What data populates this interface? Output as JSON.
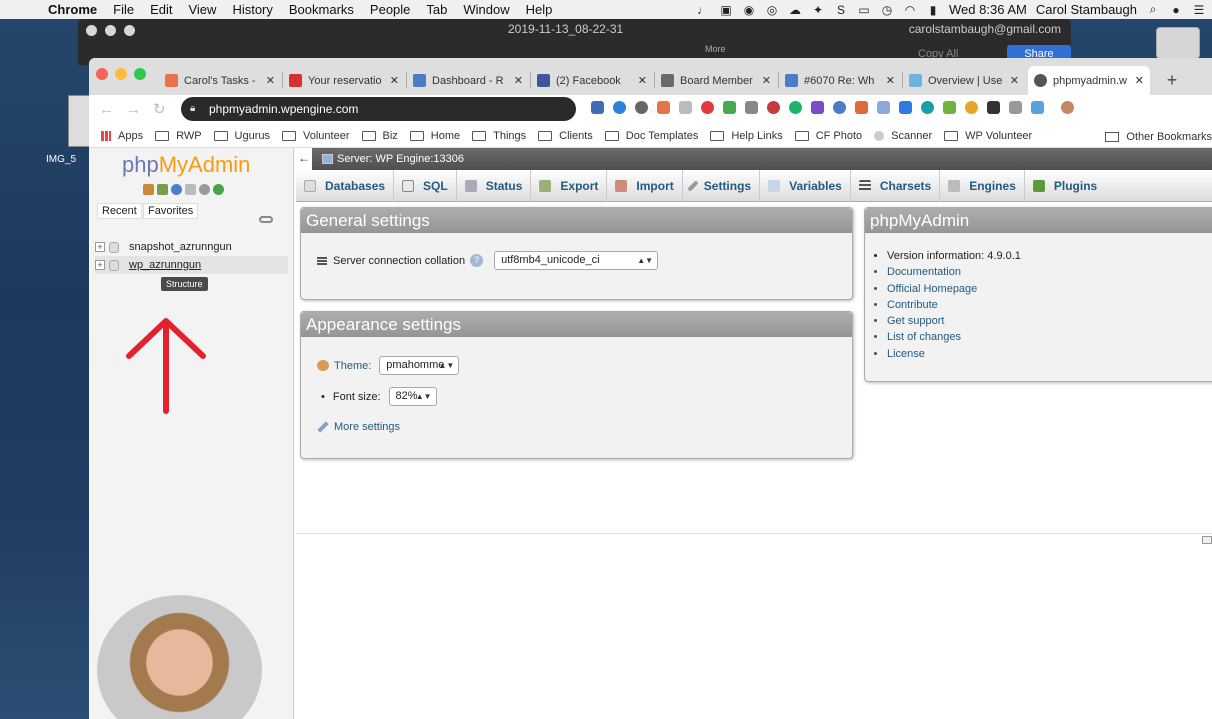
{
  "menubar": {
    "app": "Chrome",
    "items": [
      "File",
      "Edit",
      "View",
      "History",
      "Bookmarks",
      "People",
      "Tab",
      "Window",
      "Help"
    ],
    "clock": "Wed 8:36 AM",
    "user": "Carol Stambaugh"
  },
  "desktop": {
    "file_label": "IMG_5"
  },
  "quicktime": {
    "title": "2019-11-13_08-22-31",
    "email": "carolstambaugh@gmail.com",
    "more": "More",
    "copy": "Copy All",
    "share": "Share"
  },
  "tabs": [
    {
      "title": "Carol's Tasks -",
      "color": "#e8734a"
    },
    {
      "title": "Your reservatio",
      "color": "#d7312f"
    },
    {
      "title": "Dashboard - R",
      "color": "#4a7cc8"
    },
    {
      "title": "(2) Facebook",
      "color": "#3b5998"
    },
    {
      "title": "Board Member",
      "color": "#6a6a6a"
    },
    {
      "title": "#6070 Re: Wh",
      "color": "#4a7cc8"
    },
    {
      "title": "Overview | Use",
      "color": "#6fb4e0"
    },
    {
      "title": "phpmyadmin.w",
      "color": "#555555"
    }
  ],
  "omnibox": {
    "url": "phpmyadmin.wpengine.com"
  },
  "bookmarks": {
    "items": [
      "Apps",
      "RWP",
      "Ugurus",
      "Volunteer",
      "Biz",
      "Home",
      "Things",
      "Clients",
      "Doc Templates",
      "Help Links",
      "CF Photo",
      "Scanner",
      "WP Volunteer"
    ],
    "other": "Other Bookmarks"
  },
  "pma": {
    "logo_a": "php",
    "logo_b": "MyAdmin",
    "nav_tabs": {
      "recent": "Recent",
      "favorites": "Favorites"
    },
    "databases": [
      "snapshot_azrunngun",
      "wp_azrunngun"
    ],
    "tooltip": "Structure",
    "server": "Server: WP Engine:13306",
    "menu": [
      "Databases",
      "SQL",
      "Status",
      "Export",
      "Import",
      "Settings",
      "Variables",
      "Charsets",
      "Engines",
      "Plugins"
    ],
    "general": {
      "title": "General settings",
      "collation_label": "Server connection collation",
      "collation_value": "utf8mb4_unicode_ci"
    },
    "appearance": {
      "title": "Appearance settings",
      "theme_label": "Theme:",
      "theme_value": "pmahomme",
      "font_label": "Font size:",
      "font_value": "82%",
      "more": "More settings"
    },
    "info": {
      "title": "phpMyAdmin",
      "version": "Version information: 4.9.0.1",
      "links": [
        "Documentation",
        "Official Homepage",
        "Contribute",
        "Get support",
        "List of changes",
        "License"
      ]
    }
  }
}
